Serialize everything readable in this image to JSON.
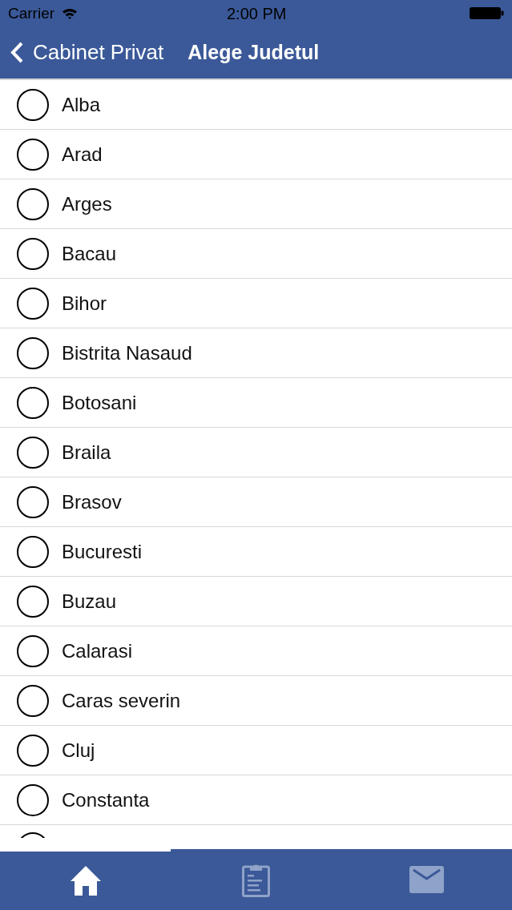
{
  "status_bar": {
    "carrier": "Carrier",
    "time": "2:00 PM"
  },
  "nav_bar": {
    "back_label": "Cabinet Privat",
    "title": "Alege Judetul"
  },
  "counties": [
    {
      "label": "Alba",
      "selected": false
    },
    {
      "label": "Arad",
      "selected": false
    },
    {
      "label": "Arges",
      "selected": false
    },
    {
      "label": "Bacau",
      "selected": false
    },
    {
      "label": "Bihor",
      "selected": false
    },
    {
      "label": "Bistrita Nasaud",
      "selected": false
    },
    {
      "label": "Botosani",
      "selected": false
    },
    {
      "label": "Braila",
      "selected": false
    },
    {
      "label": "Brasov",
      "selected": false
    },
    {
      "label": "Bucuresti",
      "selected": false
    },
    {
      "label": "Buzau",
      "selected": false
    },
    {
      "label": "Calarasi",
      "selected": false
    },
    {
      "label": "Caras severin",
      "selected": false
    },
    {
      "label": "Cluj",
      "selected": false
    },
    {
      "label": "Constanta",
      "selected": false
    },
    {
      "selected": false
    }
  ],
  "tab_bar": {
    "tabs": [
      {
        "kind": "home",
        "selected": true
      },
      {
        "kind": "clipboard",
        "selected": false
      },
      {
        "kind": "mail",
        "selected": false
      }
    ]
  }
}
